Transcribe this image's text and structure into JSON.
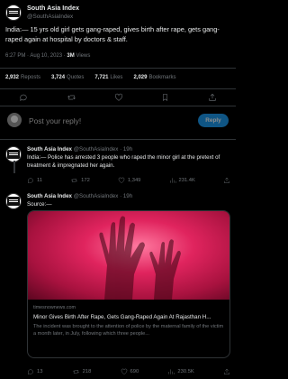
{
  "main_tweet": {
    "display_name": "South Asia Index",
    "handle": "@SouthAsiaIndex",
    "text": "India:— 15 yrs old girl gets gang-raped, gives birth after rape, gets gang-raped again at hospital by doctors & staff.",
    "time": "6:27 PM",
    "date": "Aug 10, 2023",
    "separator": "·",
    "views_count": "3M",
    "views_label": "Views",
    "stats": [
      {
        "count": "2,932",
        "label": "Reposts"
      },
      {
        "count": "3,724",
        "label": "Quotes"
      },
      {
        "count": "7,721",
        "label": "Likes"
      },
      {
        "count": "2,029",
        "label": "Bookmarks"
      }
    ]
  },
  "reply_box": {
    "placeholder": "Post your reply!",
    "button_label": "Reply"
  },
  "replies": [
    {
      "display_name": "South Asia Index",
      "handle": "@SouthAsiaIndex",
      "age": "19h",
      "text": "India:— Police has arrested 3 people who raped the minor girl at the pretext of treatment & impregnated her again.",
      "actions": {
        "replies": "11",
        "reposts": "172",
        "likes": "1,349",
        "views": "231.4K"
      }
    },
    {
      "display_name": "South Asia Index",
      "handle": "@SouthAsiaIndex",
      "age": "19h",
      "text": "Source:—",
      "card": {
        "domain": "timesnownews.com",
        "title": "Minor Gives Birth After Rape, Gets Gang-Raped Again At Rajasthan H...",
        "description": "The incident was brought to the attention of police by the maternal family of the victim a month later, in July, following which three people..."
      },
      "actions": {
        "replies": "13",
        "reposts": "218",
        "likes": "690",
        "views": "230.5K"
      }
    }
  ],
  "colors": {
    "background": "#000000",
    "accent": "#1d9bf0",
    "muted": "#71767b",
    "text": "#e7e9ea"
  }
}
